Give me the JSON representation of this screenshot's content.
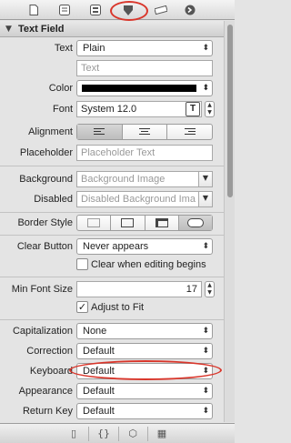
{
  "toolbar": {
    "icons": [
      "file-inspector-icon",
      "quick-help-icon",
      "identity-inspector-icon",
      "attributes-inspector-icon",
      "size-inspector-icon",
      "connections-inspector-icon"
    ]
  },
  "section": {
    "title": "Text Field"
  },
  "rows": {
    "text": {
      "label": "Text",
      "value": "Plain"
    },
    "text_field": {
      "placeholder": "Text"
    },
    "color": {
      "label": "Color",
      "value": "#000000"
    },
    "font": {
      "label": "Font",
      "value": "System 12.0",
      "button": "T"
    },
    "alignment": {
      "label": "Alignment"
    },
    "placeholder": {
      "label": "Placeholder",
      "value": "Placeholder Text"
    },
    "background": {
      "label": "Background",
      "value": "Background Image"
    },
    "disabled": {
      "label": "Disabled",
      "value": "Disabled Background Ima"
    },
    "border_style": {
      "label": "Border Style"
    },
    "clear_button": {
      "label": "Clear Button",
      "value": "Never appears",
      "checkbox_label": "Clear when editing begins"
    },
    "min_font_size": {
      "label": "Min Font Size",
      "value": "17",
      "checkbox_label": "Adjust to Fit"
    },
    "capitalization": {
      "label": "Capitalization",
      "value": "None"
    },
    "correction": {
      "label": "Correction",
      "value": "Default"
    },
    "keyboard": {
      "label": "Keyboard",
      "value": "Default"
    },
    "appearance": {
      "label": "Appearance",
      "value": "Default"
    },
    "return_key": {
      "label": "Return Key",
      "value": "Default"
    }
  },
  "bottom_bar": {
    "icons": [
      "file-template-icon",
      "code-snippet-icon",
      "object-library-icon",
      "media-library-icon"
    ],
    "glyphs": [
      "▯",
      "{}",
      "⬡",
      "▦"
    ]
  },
  "colors": {
    "highlight_ring": "#d9362b"
  }
}
